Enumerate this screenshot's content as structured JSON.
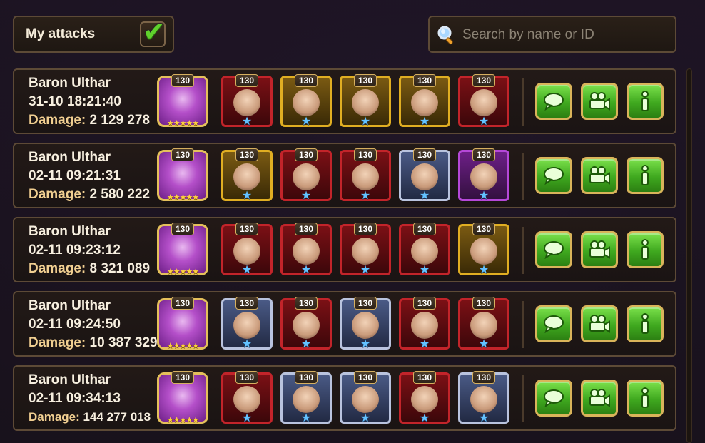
{
  "header": {
    "my_attacks_label": "My attacks",
    "my_attacks_checked": true,
    "search_placeholder": "Search by name or ID"
  },
  "colors": {
    "accent_gold": "#d9b45a",
    "button_green": "#3fa81f",
    "damage_label": "#f1cf91",
    "frame_red": "#b0151d",
    "frame_gold": "#d4a21a",
    "frame_purple": "#9b2fc4",
    "frame_silver": "#9aa6c8"
  },
  "icons": {
    "search": "magnifier-icon",
    "chat": "chat-bubble-icon",
    "replay": "video-camera-icon",
    "info": "info-icon",
    "check": "checkmark-icon"
  },
  "attacks": [
    {
      "boss": "Baron Ulthar",
      "time": "31-10 18:21:40",
      "damage_label": "Damage:",
      "damage_value": "2 129 278",
      "boss_level": "130",
      "heroes": [
        {
          "level": "130",
          "frame": "red"
        },
        {
          "level": "130",
          "frame": "gold"
        },
        {
          "level": "130",
          "frame": "gold"
        },
        {
          "level": "130",
          "frame": "gold"
        },
        {
          "level": "130",
          "frame": "red"
        }
      ]
    },
    {
      "boss": "Baron Ulthar",
      "time": "02-11 09:21:31",
      "damage_label": "Damage:",
      "damage_value": "2 580 222",
      "boss_level": "130",
      "heroes": [
        {
          "level": "130",
          "frame": "gold"
        },
        {
          "level": "130",
          "frame": "red"
        },
        {
          "level": "130",
          "frame": "red"
        },
        {
          "level": "130",
          "frame": "silver"
        },
        {
          "level": "130",
          "frame": "purple"
        }
      ]
    },
    {
      "boss": "Baron Ulthar",
      "time": "02-11 09:23:12",
      "damage_label": "Damage:",
      "damage_value": "8 321 089",
      "boss_level": "130",
      "heroes": [
        {
          "level": "130",
          "frame": "red"
        },
        {
          "level": "130",
          "frame": "red"
        },
        {
          "level": "130",
          "frame": "red"
        },
        {
          "level": "130",
          "frame": "red"
        },
        {
          "level": "130",
          "frame": "gold"
        }
      ]
    },
    {
      "boss": "Baron Ulthar",
      "time": "02-11 09:24:50",
      "damage_label": "Damage:",
      "damage_value": "10 387 329",
      "boss_level": "130",
      "heroes": [
        {
          "level": "130",
          "frame": "silver"
        },
        {
          "level": "130",
          "frame": "red"
        },
        {
          "level": "130",
          "frame": "silver"
        },
        {
          "level": "130",
          "frame": "red"
        },
        {
          "level": "130",
          "frame": "red"
        }
      ]
    },
    {
      "boss": "Baron Ulthar",
      "time": "02-11 09:34:13",
      "damage_label": "Damage:",
      "damage_value": "144 277 018",
      "boss_level": "130",
      "heroes": [
        {
          "level": "130",
          "frame": "red"
        },
        {
          "level": "130",
          "frame": "silver"
        },
        {
          "level": "130",
          "frame": "silver"
        },
        {
          "level": "130",
          "frame": "red"
        },
        {
          "level": "130",
          "frame": "silver"
        }
      ]
    }
  ]
}
